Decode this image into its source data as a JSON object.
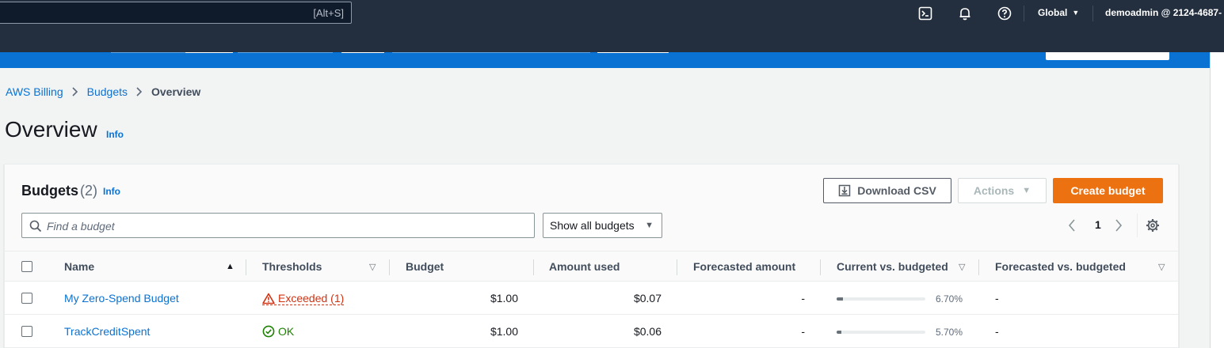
{
  "topnav": {
    "search_hint": "[Alt+S]",
    "region": "Global",
    "account": "demoadmin @ 2124-4687-"
  },
  "breadcrumb": {
    "items": [
      "AWS Billing",
      "Budgets"
    ],
    "current": "Overview"
  },
  "page": {
    "title": "Overview",
    "info": "Info"
  },
  "budgets": {
    "title": "Budgets",
    "count": "(2)",
    "info": "Info",
    "download_label": "Download CSV",
    "actions_label": "Actions",
    "create_label": "Create budget",
    "search_placeholder": "Find a budget",
    "filter_value": "Show all budgets",
    "page_number": "1"
  },
  "table": {
    "columns": [
      "Name",
      "Thresholds",
      "Budget",
      "Amount used",
      "Forecasted amount",
      "Current vs. budgeted",
      "Forecasted vs. budgeted"
    ],
    "rows": [
      {
        "name": "My Zero-Spend Budget",
        "threshold": "Exceeded (1)",
        "threshold_status": "exceeded",
        "budget": "$1.00",
        "amount_used": "$0.07",
        "forecasted_amount": "-",
        "current_vs_budgeted_pct": "6.70%",
        "current_vs_budgeted_fraction": 0.067,
        "forecasted_vs_budgeted": "-"
      },
      {
        "name": "TrackCreditSpent",
        "threshold": "OK",
        "threshold_status": "ok",
        "budget": "$1.00",
        "amount_used": "$0.06",
        "forecasted_amount": "-",
        "current_vs_budgeted_pct": "5.70%",
        "current_vs_budgeted_fraction": 0.057,
        "forecasted_vs_budgeted": "-"
      }
    ]
  },
  "colors": {
    "nav_bg": "#232f3e",
    "banner_bg": "#0972d3",
    "link": "#0972d3",
    "primary_button": "#ec7211",
    "error": "#d13212",
    "success": "#1d8102"
  }
}
